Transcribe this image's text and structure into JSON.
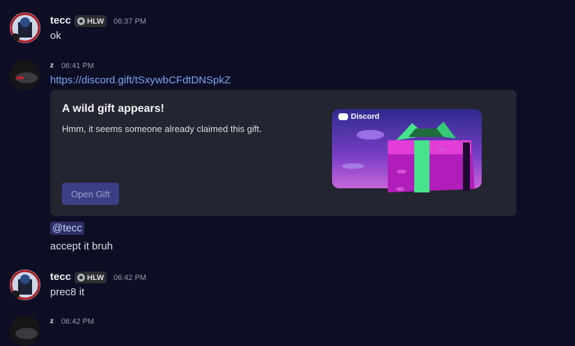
{
  "messages": [
    {
      "username": "tecc",
      "tag": "HLW",
      "time": "06:37 PM",
      "text": "ok"
    },
    {
      "author_marker": "z",
      "time": "06:41 PM",
      "link": "https://discord.gift/tSxywbCFdtDNSpkZ"
    },
    {
      "username": "tecc",
      "tag": "HLW",
      "time": "06:42 PM",
      "text": "prec8 it"
    },
    {
      "author_marker": "z",
      "time": "06:42 PM"
    }
  ],
  "embed": {
    "title": "A wild gift appears!",
    "description": "Hmm, it seems someone already claimed this gift.",
    "button_label": "Open Gift",
    "brand": "Discord"
  },
  "followup": {
    "mention": "@tecc",
    "text": "accept it bruh"
  },
  "colors": {
    "background": "#0d0d24",
    "link": "#7aa7ef",
    "embed": "#232531",
    "button": "#3c3f86",
    "mention": "#2d3066"
  }
}
